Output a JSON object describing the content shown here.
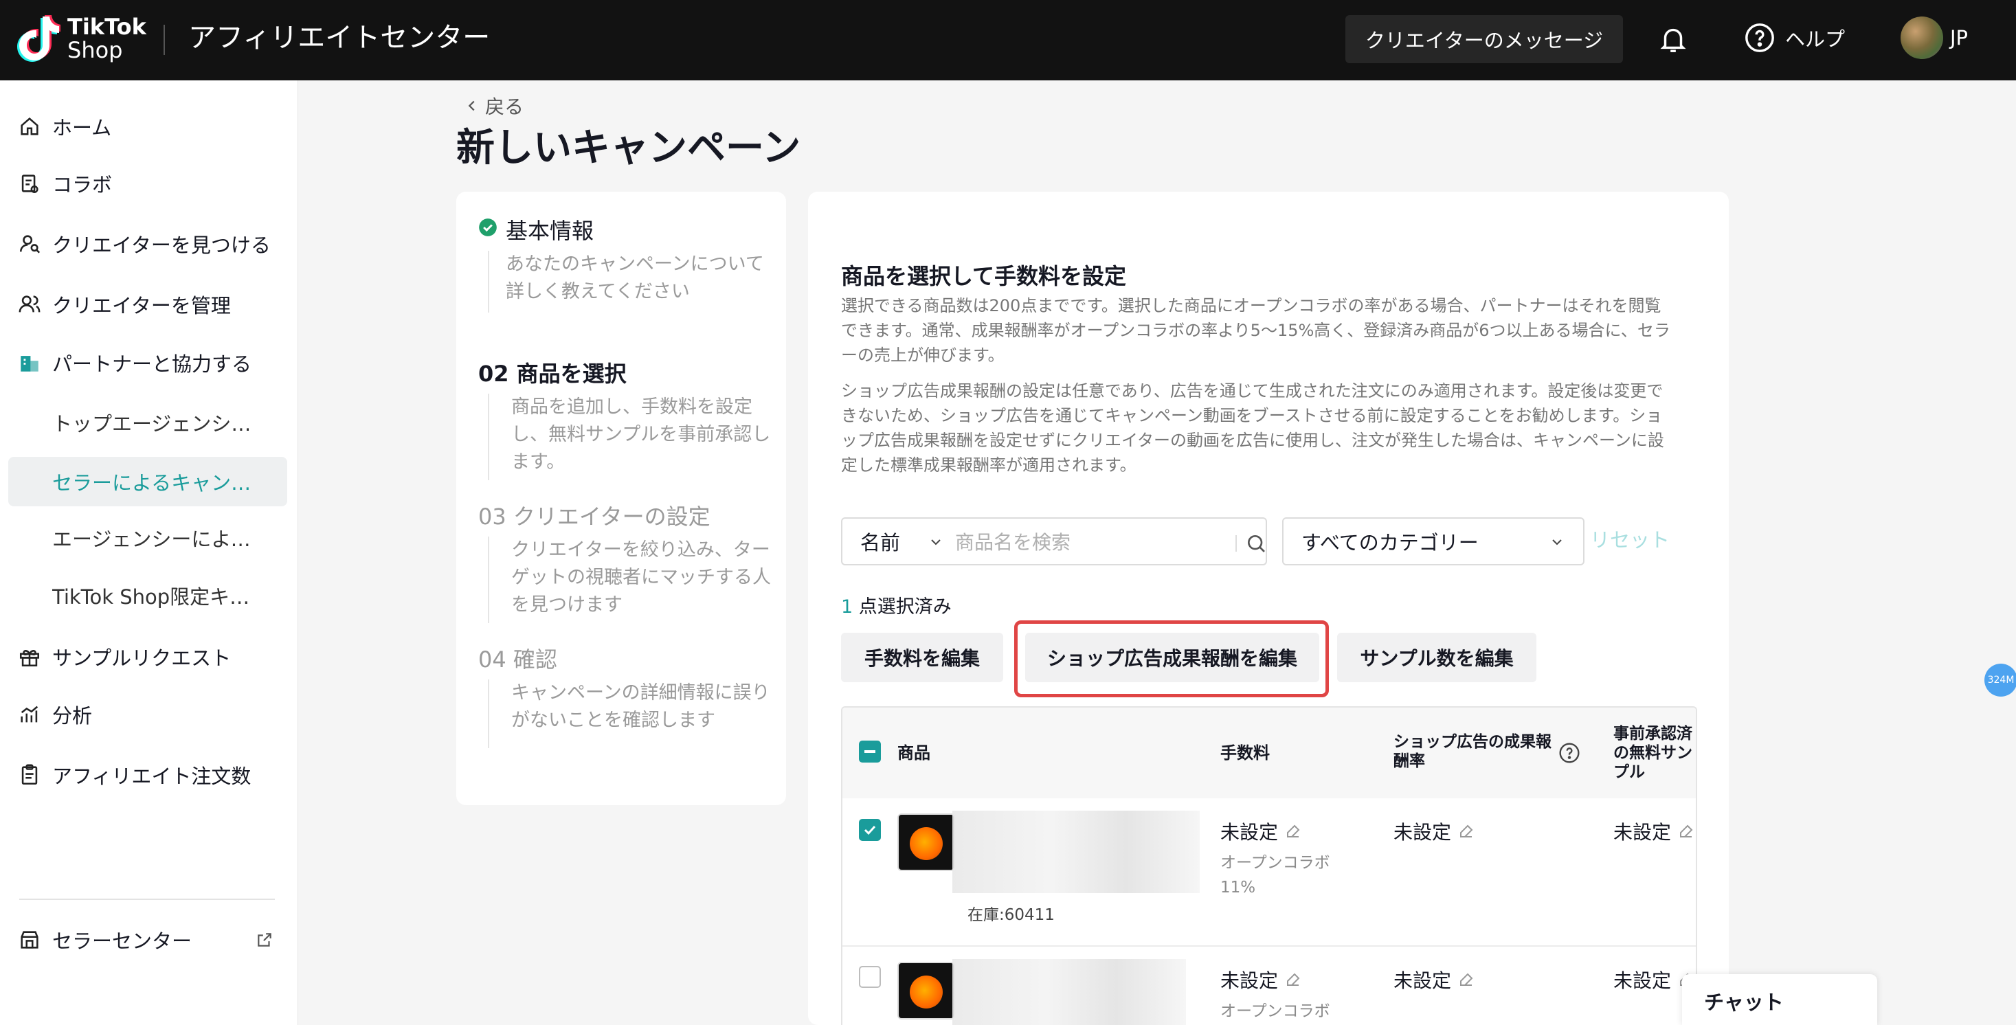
{
  "header": {
    "logo_line1": "TikTok",
    "logo_line2": "Shop",
    "app_title": "アフィリエイトセンター",
    "creator_messages": "クリエイターのメッセージ",
    "help": "ヘルプ",
    "region": "JP"
  },
  "sidebar": {
    "items": [
      {
        "label": "ホーム",
        "icon": "home-icon"
      },
      {
        "label": "コラボ",
        "icon": "clipboard-icon"
      },
      {
        "label": "クリエイターを見つける",
        "icon": "user-search-icon"
      },
      {
        "label": "クリエイターを管理",
        "icon": "users-icon"
      },
      {
        "label": "パートナーと協力する",
        "icon": "building-icon"
      }
    ],
    "subitems": [
      {
        "label": "トップエージェンシー…"
      },
      {
        "label": "セラーによるキャンペ…",
        "active": true
      },
      {
        "label": "エージェンシーによる…"
      },
      {
        "label": "TikTok Shop限定キャン…"
      }
    ],
    "lower_items": [
      {
        "label": "サンプルリクエスト",
        "icon": "gift-icon"
      },
      {
        "label": "分析",
        "icon": "chart-icon"
      },
      {
        "label": "アフィリエイト注文数",
        "icon": "order-icon"
      }
    ],
    "seller_center": "セラーセンター"
  },
  "main": {
    "back": "戻る",
    "title": "新しいキャンペーン"
  },
  "steps": [
    {
      "title": "基本情報",
      "desc": "あなたのキャンペーンについて詳しく教えてください",
      "status": "done"
    },
    {
      "title": "02 商品を選択",
      "desc": "商品を追加し、手数料を設定し、無料サンプルを事前承認します。",
      "status": "current"
    },
    {
      "title": "03 クリエイターの設定",
      "desc": "クリエイターを絞り込み、ターゲットの視聴者にマッチする人を見つけます",
      "status": "pending"
    },
    {
      "title": "04 確認",
      "desc": "キャンペーンの詳細情報に誤りがないことを確認します",
      "status": "pending"
    }
  ],
  "section": {
    "title": "商品を選択して手数料を設定",
    "para1": "選択できる商品数は200点までです。選択した商品にオープンコラボの率がある場合、パートナーはそれを閲覧できます。通常、成果報酬率がオープンコラボの率より5～15%高く、登録済み商品が6つ以上ある場合に、セラーの売上が伸びます。",
    "para2": "ショップ広告成果報酬の設定は任意であり、広告を通じて生成された注文にのみ適用されます。設定後は変更できないため、ショップ広告を通じてキャンペーン動画をブーストさせる前に設定することをお勧めします。ショップ広告成果報酬を設定せずにクリエイターの動画を広告に使用し、注文が発生した場合は、キャンペーンに設定した標準成果報酬率が適用されます。"
  },
  "filters": {
    "name_label": "名前",
    "search_placeholder": "商品名を検索",
    "category": "すべてのカテゴリー",
    "reset": "リセット"
  },
  "selection": {
    "count": "1",
    "suffix": " 点選択済み"
  },
  "actions": {
    "edit_commission": "手数料を編集",
    "edit_shop_ads": "ショップ広告成果報酬を編集",
    "edit_samples": "サンプル数を編集"
  },
  "table": {
    "headers": {
      "product": "商品",
      "commission": "手数料",
      "shop_ads_rate": "ショップ広告の成果報酬率",
      "preapproved": "事前承認済の無料サンプル"
    },
    "rows": [
      {
        "checked": true,
        "stock": "在庫:60411",
        "commission": "未設定",
        "open_collab": "オープンコラボ",
        "open_collab_rate": "11%",
        "shop_ads": "未設定",
        "samples": "未設定"
      },
      {
        "checked": false,
        "commission": "未設定",
        "open_collab": "オープンコラボ",
        "shop_ads": "未設定",
        "samples": "未設定"
      }
    ]
  },
  "chat": "チャット",
  "badge": "324M",
  "colors": {
    "accent": "#1a9c9b",
    "highlight": "#e04545",
    "topbar": "#121212"
  }
}
